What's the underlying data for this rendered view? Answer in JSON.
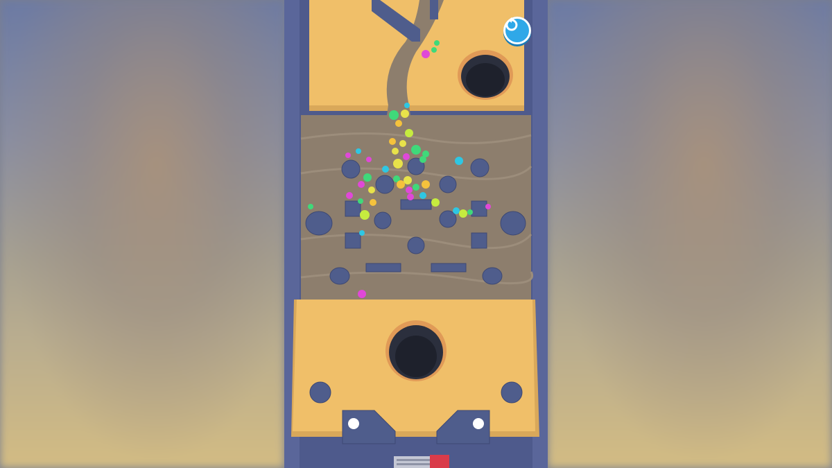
{
  "game": {
    "title": "",
    "restart_icon": "restart-icon",
    "colors": {
      "wall": "#4e5a8c",
      "sand": "#f0bf69",
      "dug_floor": "#8d7e6d",
      "obstacle": "#4f5d8c",
      "hole": "#2b2f3d",
      "restart_button": "#2fa8e8"
    },
    "ball_colors": [
      "#3fd97a",
      "#e8e24a",
      "#f5c23c",
      "#e048d8",
      "#2ec7e3",
      "#c6ec3f"
    ]
  }
}
